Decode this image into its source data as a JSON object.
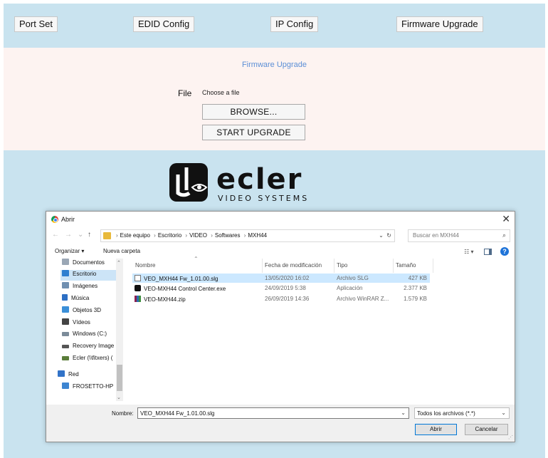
{
  "nav": {
    "port_set": "Port Set",
    "edid_config": "EDID Config",
    "ip_config": "IP Config",
    "firmware_upgrade": "Firmware Upgrade"
  },
  "upgrade_panel": {
    "title": "Firmware Upgrade",
    "file_label": "File",
    "file_hint": "Choose a file",
    "browse_label": "BROWSE...",
    "start_label": "START UPGRADE"
  },
  "logo": {
    "brand": "ecler",
    "tagline": "VIDEO SYSTEMS"
  },
  "dialog": {
    "title": "Abrir",
    "close": "✕",
    "breadcrumb": [
      "Este equipo",
      "Escritorio",
      "VIDEO",
      "Softwares",
      "MXH44"
    ],
    "search_placeholder": "Buscar en MXH44",
    "organize": "Organizar ▾",
    "new_folder": "Nueva carpeta",
    "sidebar": [
      {
        "label": "Documentos",
        "icon": "document-icon",
        "color": "#9aa7b5"
      },
      {
        "label": "Escritorio",
        "icon": "desktop-icon",
        "color": "#2f7fd0",
        "selected": true
      },
      {
        "label": "Imágenes",
        "icon": "images-icon",
        "color": "#6f8fb0"
      },
      {
        "label": "Música",
        "icon": "music-icon",
        "color": "#2d6fc4"
      },
      {
        "label": "Objetos 3D",
        "icon": "objects3d-icon",
        "color": "#3b8fd8"
      },
      {
        "label": "Vídeos",
        "icon": "videos-icon",
        "color": "#444444"
      },
      {
        "label": "Windows (C:)",
        "icon": "drive-icon",
        "color": "#7b8b99"
      },
      {
        "label": "Recovery Image",
        "icon": "drive-icon",
        "color": "#555555"
      },
      {
        "label": "Ecler (\\\\fitxers) (",
        "icon": "network-drive-icon",
        "color": "#5a7d3a"
      },
      {
        "label": "Red",
        "icon": "network-icon",
        "color": "#3273c8"
      },
      {
        "label": "FROSETTO-HP",
        "icon": "computer-icon",
        "color": "#3d85d1"
      }
    ],
    "columns": {
      "name": "Nombre",
      "modified": "Fecha de modificación",
      "type": "Tipo",
      "size": "Tamaño"
    },
    "files": [
      {
        "name": "VEO_MXH44 Fw_1.01.00.slg",
        "modified": "13/05/2020 16:02",
        "type": "Archivo SLG",
        "size": "427 KB",
        "icon": "file-icon",
        "selected": true
      },
      {
        "name": "VEO-MXH44 Control Center.exe",
        "modified": "24/09/2019 5:38",
        "type": "Aplicación",
        "size": "2.377 KB",
        "icon": "app-icon"
      },
      {
        "name": "VEO-MXH44.zip",
        "modified": "26/09/2019 14:36",
        "type": "Archivo WinRAR Z...",
        "size": "1.579 KB",
        "icon": "winrar-icon"
      }
    ],
    "filename_label": "Nombre:",
    "filename_value": "VEO_MXH44 Fw_1.01.00.slg",
    "filetype_value": "Todos los archivos (*.*)",
    "open_label": "Abrir",
    "cancel_label": "Cancelar"
  },
  "colors": {
    "nav_bg": "#c9e3ef",
    "panel_bg": "#fdf3f1",
    "title_blue": "#5c8fd6",
    "selection": "#cce8ff"
  }
}
